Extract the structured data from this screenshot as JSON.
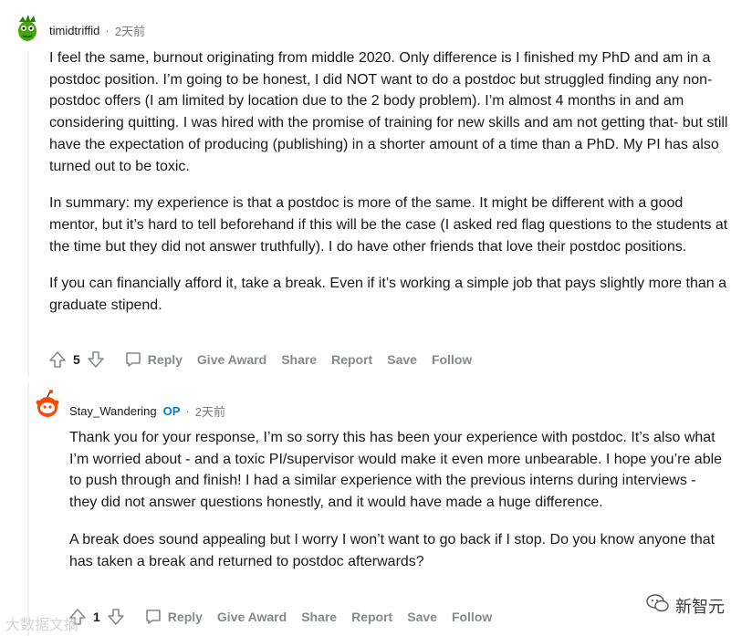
{
  "comment1": {
    "author": "timidtriffid",
    "time": "2天前",
    "paragraphs": [
      "I feel the same, burnout originating from middle 2020. Only difference is I finished my PhD and am in a postdoc position. I’m going to be honest, I did NOT want to do a postdoc but struggled finding any non-postdoc offers (I am limited by location due to the 2 body problem). I’m almost 4 months in and am considering quitting. I was hired with the promise of training for new skills and am not getting that- but still have the expectation of producing (publishing) in a shorter amount of a time than a PhD. My PI has also turned out to be toxic.",
      "In summary: my experience is that a postdoc is more of the same. It might be different with a good mentor, but it’s hard to tell beforehand if this will be the case (I asked red flag questions to the students at the time but they did not answer truthfully). I do have other friends that love their postdoc positions.",
      "If you can financially afford it, take a break. Even if it’s working a simple job that pays slightly more than a graduate stipend."
    ],
    "score": "5",
    "actions": {
      "reply": "Reply",
      "award": "Give Award",
      "share": "Share",
      "report": "Report",
      "save": "Save",
      "follow": "Follow"
    }
  },
  "comment2": {
    "author": "Stay_Wandering",
    "op_badge": "OP",
    "time": "2天前",
    "paragraphs": [
      "Thank you for your response, I’m so sorry this has been your experience with postdoc. It’s also what I’m worried about - and a toxic PI/supervisor would make it even more unbearable. I hope you’re able to push through and finish! I had a similar experience with the previous interns during interviews - they did not answer questions honestly, and it would have made a huge difference.",
      "A break does sound appealing but I worry I won’t want to go back if I stop. Do you know anyone that has taken a break and returned to postdoc afterwards?"
    ],
    "score": "1",
    "actions": {
      "reply": "Reply",
      "award": "Give Award",
      "share": "Share",
      "report": "Report",
      "save": "Save",
      "follow": "Follow"
    }
  },
  "watermark": {
    "left": "大数据文摘",
    "right": "新智元"
  },
  "colors": {
    "op": "#0079d3",
    "meta": "#7c7c7c",
    "action": "#878a8c"
  }
}
